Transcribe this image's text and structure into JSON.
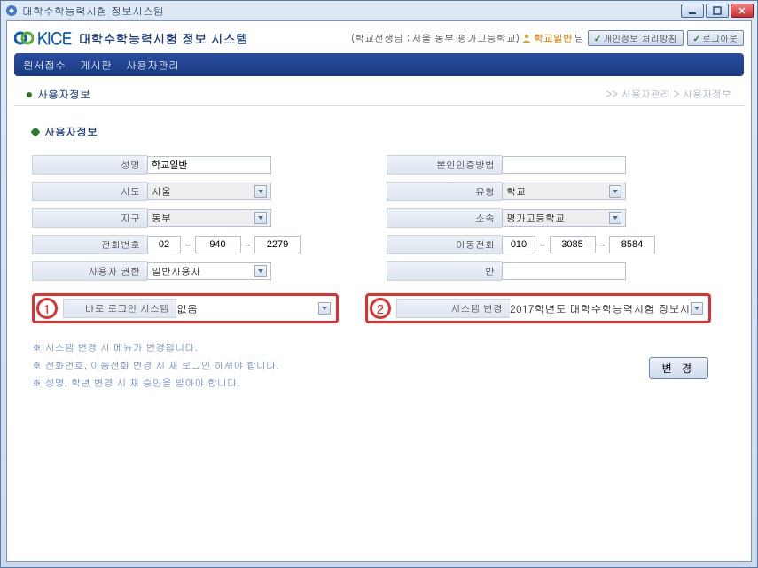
{
  "window": {
    "title": "대학수학능력시험 정보시스템"
  },
  "winbtns": {
    "min": "minimize",
    "max": "maximize",
    "close": "close"
  },
  "header": {
    "logo_brand": "KICE",
    "logo_subtitle": "대학수학능력시험 정보 시스템",
    "user_prefix": "(학교선생님 :",
    "user_loc": "서울 동부 평가고등학교)",
    "user_role": "학교일반",
    "user_suffix": "님",
    "btn_privacy": "개인정보 처리방침",
    "btn_logout": "로그아웃"
  },
  "nav": {
    "items": [
      "원서접수",
      "게시판",
      "사용자관리"
    ]
  },
  "crumb": {
    "page": "사용자정보",
    "path": ">> 사용자관리  >  사용자정보"
  },
  "section": {
    "title": "사용자정보"
  },
  "form": {
    "name_label": "성명",
    "name_val": "학교일반",
    "auth_label": "본인인증방법",
    "auth_val": "",
    "sido_label": "시도",
    "sido_val": "서울",
    "type_label": "유형",
    "type_val": "학교",
    "district_label": "지구",
    "district_val": "동부",
    "org_label": "소속",
    "org_val": "평가고등학교",
    "tel_label": "전화번호",
    "tel1": "02",
    "tel2": "940",
    "tel3": "2279",
    "mobile_label": "이동전화",
    "mob1": "010",
    "mob2": "3085",
    "mob3": "8584",
    "perm_label": "사용자 권한",
    "perm_val": "일반사용자",
    "class_label": "반",
    "class_val": "",
    "login_label": "바로 로그인 시스템",
    "login_val": "없음",
    "syschg_label": "시스템 변경",
    "syschg_val": "2017학년도 대학수학능력시험 정보시"
  },
  "markers": {
    "one": "1",
    "two": "2"
  },
  "notes": {
    "n1": "※ 시스템 변경 시 메뉴가 변경됩니다.",
    "n2": "※ 전화번호, 이동전화 변경 시 재 로그인 하셔야 합니다.",
    "n3": "※ 성명, 학년 변경 시 재 승인을 받아야 합니다."
  },
  "buttons": {
    "change": "변 경"
  }
}
